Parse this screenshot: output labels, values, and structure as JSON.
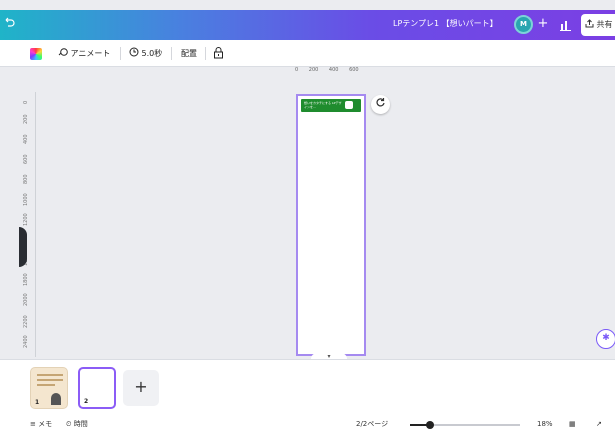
{
  "topbar": {
    "undo_icon": "undo-icon",
    "doc_title": "LPテンプレ1 【想いパート】",
    "avatar_initials": "M",
    "plus_label": "+",
    "share_label": "共有"
  },
  "toolbar": {
    "animate_label": "アニメート",
    "duration_label": "5.0秒",
    "position_label": "配置"
  },
  "canvas": {
    "ruler_top": [
      "0",
      "200",
      "400",
      "600"
    ],
    "ruler_left": [
      "0",
      "200",
      "400",
      "600",
      "800",
      "1000",
      "1200",
      "1400",
      "1600",
      "1800",
      "2000",
      "2200",
      "2400"
    ],
    "banner_text": "想いをカタチにする LPデザインを…"
  },
  "pages": {
    "items": [
      {
        "number": "1"
      },
      {
        "number": "2"
      }
    ],
    "add_label": "+"
  },
  "footer": {
    "notes_label": "メモ",
    "timer_label": "時間",
    "page_indicator": "2/2ページ",
    "zoom_percent": "18%",
    "zoom_level": 0.18
  },
  "colors": {
    "accent": "#8b5cf6",
    "banner": "#1f8c2e"
  }
}
